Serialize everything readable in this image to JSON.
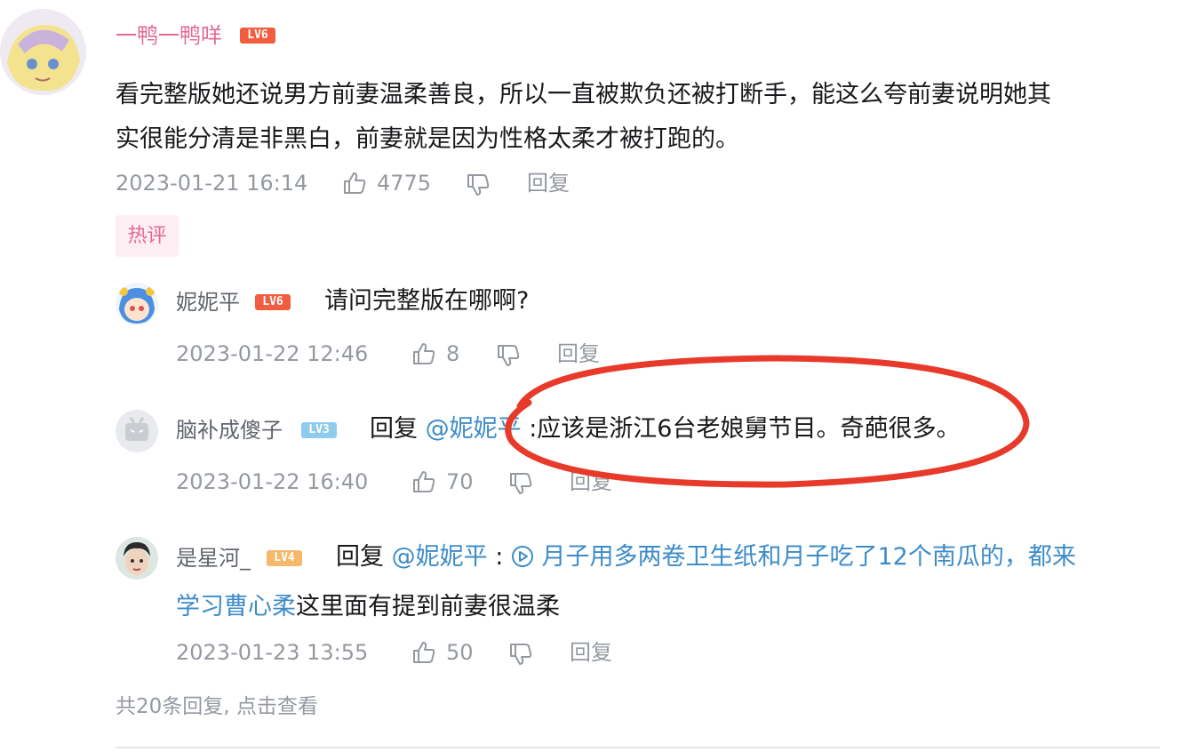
{
  "main_comment": {
    "username": "一鸭一鸭咩",
    "level": "LV6",
    "text_line1": "看完整版她还说男方前妻温柔善良，所以一直被欺负还被打断手，能这么夸前妻说明她其",
    "text_line2": "实很能分清是非黑白，前妻就是因为性格太柔才被打跑的。",
    "time": "2023-01-21 16:14",
    "likes": "4775",
    "reply_label": "回复",
    "hot_badge": "热评"
  },
  "replies": [
    {
      "username": "妮妮平",
      "level": "LV6",
      "text": "请问完整版在哪啊?",
      "time": "2023-01-22 12:46",
      "likes": "8",
      "reply_label": "回复"
    },
    {
      "username": "脑补成傻子",
      "level": "LV3",
      "reply_prefix": "回复",
      "mention": "@妮妮平",
      "text": ":应该是浙江6台老娘舅节目。奇葩很多。",
      "time": "2023-01-22 16:40",
      "likes": "70",
      "reply_label": "回复"
    },
    {
      "username": "是星河_",
      "level": "LV4",
      "reply_prefix": "回复",
      "mention": "@妮妮平",
      "colon": ":",
      "link_line1": "月子用多两卷卫生纸和月子吃了12个南瓜的，都来",
      "link_line2": "学习曹心柔",
      "text_tail": "这里面有提到前妻很温柔",
      "time": "2023-01-23 13:55",
      "likes": "50",
      "reply_label": "回复"
    }
  ],
  "footer": {
    "more_replies": "共20条回复, 点击查看"
  },
  "colors": {
    "accent_pink": "#e26a8f",
    "lv6": "#f25d3f",
    "lv3": "#8ecbed",
    "lv4": "#f6b86a",
    "link": "#3c8cc8",
    "annotation_red": "#e83a2a"
  }
}
